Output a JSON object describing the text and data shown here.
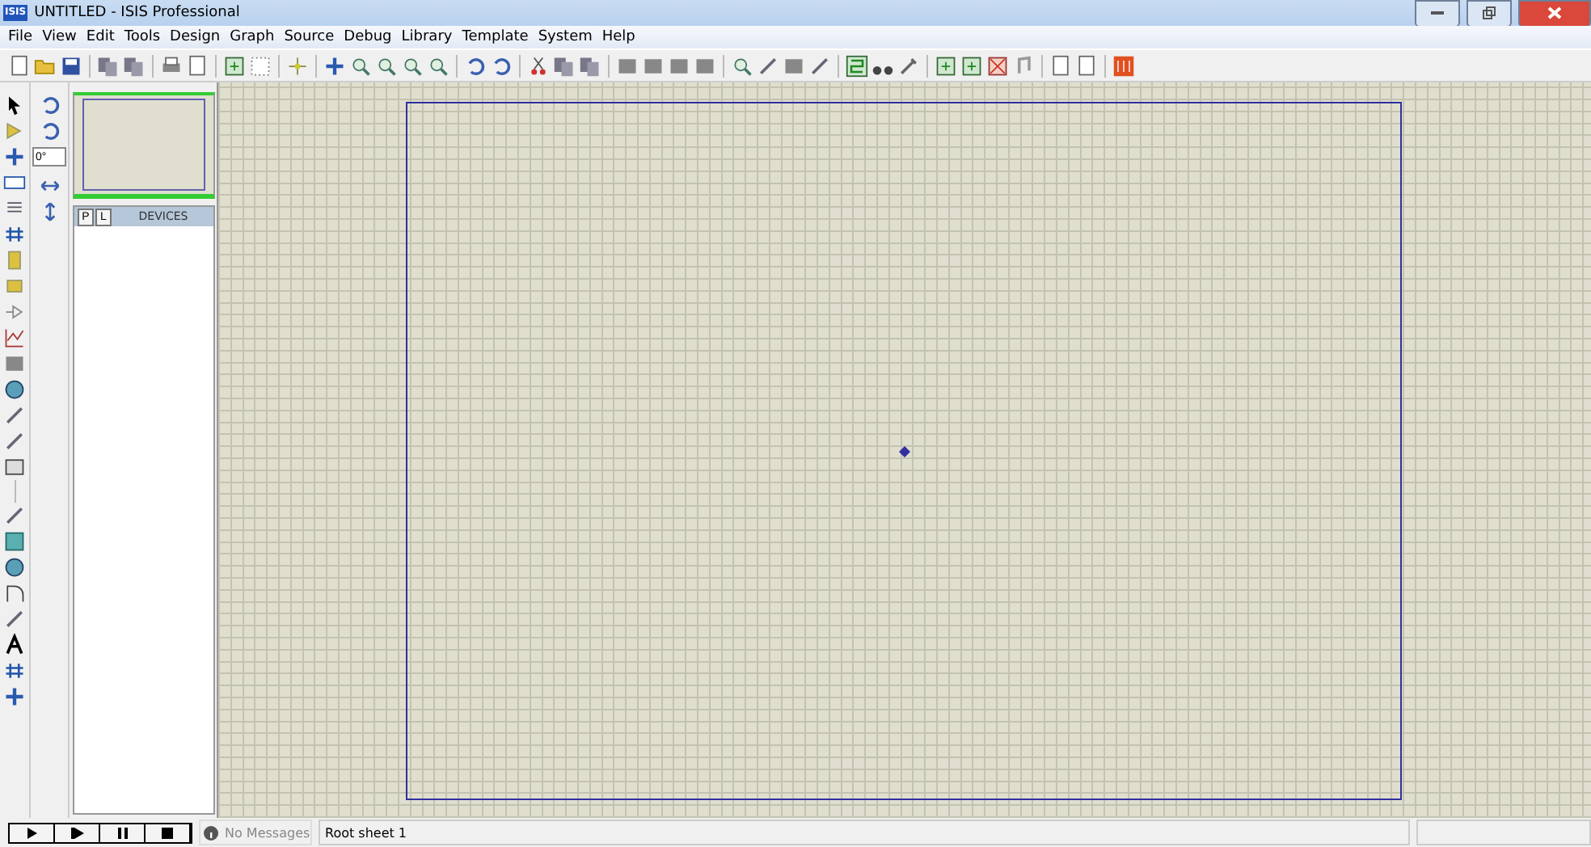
{
  "window": {
    "title": "UNTITLED - ISIS Professional",
    "logo": "ISIS"
  },
  "menu": [
    "File",
    "View",
    "Edit",
    "Tools",
    "Design",
    "Graph",
    "Source",
    "Debug",
    "Library",
    "Template",
    "System",
    "Help"
  ],
  "rotation_field": {
    "value": "0°"
  },
  "panel_tabs": [
    {
      "label": "P",
      "selected": false
    },
    {
      "label": "L",
      "selected": false
    }
  ],
  "panel_header": "DEVICES",
  "status_bar": {
    "messages": "No Messages",
    "sheet": "Root sheet 1"
  }
}
